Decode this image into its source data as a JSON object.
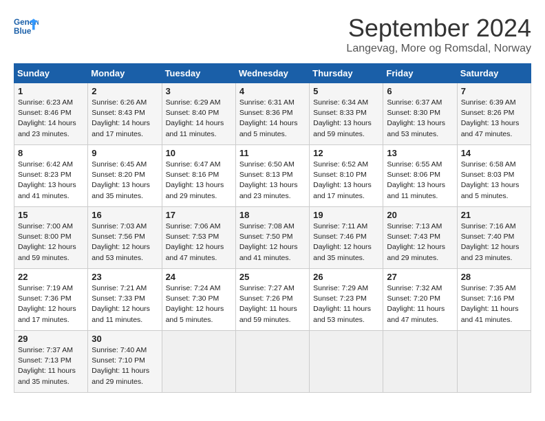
{
  "header": {
    "month_title": "September 2024",
    "location": "Langevag, More og Romsdal, Norway"
  },
  "logo": {
    "general": "General",
    "blue": "Blue"
  },
  "days_of_week": [
    "Sunday",
    "Monday",
    "Tuesday",
    "Wednesday",
    "Thursday",
    "Friday",
    "Saturday"
  ],
  "weeks": [
    [
      {
        "day": 1,
        "lines": [
          "Sunrise: 6:23 AM",
          "Sunset: 8:46 PM",
          "Daylight: 14 hours",
          "and 23 minutes."
        ]
      },
      {
        "day": 2,
        "lines": [
          "Sunrise: 6:26 AM",
          "Sunset: 8:43 PM",
          "Daylight: 14 hours",
          "and 17 minutes."
        ]
      },
      {
        "day": 3,
        "lines": [
          "Sunrise: 6:29 AM",
          "Sunset: 8:40 PM",
          "Daylight: 14 hours",
          "and 11 minutes."
        ]
      },
      {
        "day": 4,
        "lines": [
          "Sunrise: 6:31 AM",
          "Sunset: 8:36 PM",
          "Daylight: 14 hours",
          "and 5 minutes."
        ]
      },
      {
        "day": 5,
        "lines": [
          "Sunrise: 6:34 AM",
          "Sunset: 8:33 PM",
          "Daylight: 13 hours",
          "and 59 minutes."
        ]
      },
      {
        "day": 6,
        "lines": [
          "Sunrise: 6:37 AM",
          "Sunset: 8:30 PM",
          "Daylight: 13 hours",
          "and 53 minutes."
        ]
      },
      {
        "day": 7,
        "lines": [
          "Sunrise: 6:39 AM",
          "Sunset: 8:26 PM",
          "Daylight: 13 hours",
          "and 47 minutes."
        ]
      }
    ],
    [
      {
        "day": 8,
        "lines": [
          "Sunrise: 6:42 AM",
          "Sunset: 8:23 PM",
          "Daylight: 13 hours",
          "and 41 minutes."
        ]
      },
      {
        "day": 9,
        "lines": [
          "Sunrise: 6:45 AM",
          "Sunset: 8:20 PM",
          "Daylight: 13 hours",
          "and 35 minutes."
        ]
      },
      {
        "day": 10,
        "lines": [
          "Sunrise: 6:47 AM",
          "Sunset: 8:16 PM",
          "Daylight: 13 hours",
          "and 29 minutes."
        ]
      },
      {
        "day": 11,
        "lines": [
          "Sunrise: 6:50 AM",
          "Sunset: 8:13 PM",
          "Daylight: 13 hours",
          "and 23 minutes."
        ]
      },
      {
        "day": 12,
        "lines": [
          "Sunrise: 6:52 AM",
          "Sunset: 8:10 PM",
          "Daylight: 13 hours",
          "and 17 minutes."
        ]
      },
      {
        "day": 13,
        "lines": [
          "Sunrise: 6:55 AM",
          "Sunset: 8:06 PM",
          "Daylight: 13 hours",
          "and 11 minutes."
        ]
      },
      {
        "day": 14,
        "lines": [
          "Sunrise: 6:58 AM",
          "Sunset: 8:03 PM",
          "Daylight: 13 hours",
          "and 5 minutes."
        ]
      }
    ],
    [
      {
        "day": 15,
        "lines": [
          "Sunrise: 7:00 AM",
          "Sunset: 8:00 PM",
          "Daylight: 12 hours",
          "and 59 minutes."
        ]
      },
      {
        "day": 16,
        "lines": [
          "Sunrise: 7:03 AM",
          "Sunset: 7:56 PM",
          "Daylight: 12 hours",
          "and 53 minutes."
        ]
      },
      {
        "day": 17,
        "lines": [
          "Sunrise: 7:06 AM",
          "Sunset: 7:53 PM",
          "Daylight: 12 hours",
          "and 47 minutes."
        ]
      },
      {
        "day": 18,
        "lines": [
          "Sunrise: 7:08 AM",
          "Sunset: 7:50 PM",
          "Daylight: 12 hours",
          "and 41 minutes."
        ]
      },
      {
        "day": 19,
        "lines": [
          "Sunrise: 7:11 AM",
          "Sunset: 7:46 PM",
          "Daylight: 12 hours",
          "and 35 minutes."
        ]
      },
      {
        "day": 20,
        "lines": [
          "Sunrise: 7:13 AM",
          "Sunset: 7:43 PM",
          "Daylight: 12 hours",
          "and 29 minutes."
        ]
      },
      {
        "day": 21,
        "lines": [
          "Sunrise: 7:16 AM",
          "Sunset: 7:40 PM",
          "Daylight: 12 hours",
          "and 23 minutes."
        ]
      }
    ],
    [
      {
        "day": 22,
        "lines": [
          "Sunrise: 7:19 AM",
          "Sunset: 7:36 PM",
          "Daylight: 12 hours",
          "and 17 minutes."
        ]
      },
      {
        "day": 23,
        "lines": [
          "Sunrise: 7:21 AM",
          "Sunset: 7:33 PM",
          "Daylight: 12 hours",
          "and 11 minutes."
        ]
      },
      {
        "day": 24,
        "lines": [
          "Sunrise: 7:24 AM",
          "Sunset: 7:30 PM",
          "Daylight: 12 hours",
          "and 5 minutes."
        ]
      },
      {
        "day": 25,
        "lines": [
          "Sunrise: 7:27 AM",
          "Sunset: 7:26 PM",
          "Daylight: 11 hours",
          "and 59 minutes."
        ]
      },
      {
        "day": 26,
        "lines": [
          "Sunrise: 7:29 AM",
          "Sunset: 7:23 PM",
          "Daylight: 11 hours",
          "and 53 minutes."
        ]
      },
      {
        "day": 27,
        "lines": [
          "Sunrise: 7:32 AM",
          "Sunset: 7:20 PM",
          "Daylight: 11 hours",
          "and 47 minutes."
        ]
      },
      {
        "day": 28,
        "lines": [
          "Sunrise: 7:35 AM",
          "Sunset: 7:16 PM",
          "Daylight: 11 hours",
          "and 41 minutes."
        ]
      }
    ],
    [
      {
        "day": 29,
        "lines": [
          "Sunrise: 7:37 AM",
          "Sunset: 7:13 PM",
          "Daylight: 11 hours",
          "and 35 minutes."
        ]
      },
      {
        "day": 30,
        "lines": [
          "Sunrise: 7:40 AM",
          "Sunset: 7:10 PM",
          "Daylight: 11 hours",
          "and 29 minutes."
        ]
      },
      null,
      null,
      null,
      null,
      null
    ]
  ]
}
